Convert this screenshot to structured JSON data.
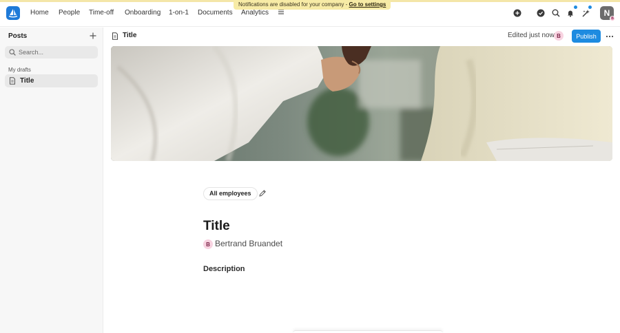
{
  "banner": {
    "text": "Notifications are disabled for your company - ",
    "link": "Go to settings"
  },
  "nav": {
    "items": [
      "Home",
      "People",
      "Time-off",
      "Onboarding",
      "1-on-1",
      "Documents",
      "Analytics"
    ],
    "user_initial": "N",
    "user_badge": "B"
  },
  "sidebar": {
    "title": "Posts",
    "search_placeholder": "Search...",
    "section_label": "My drafts",
    "items": [
      {
        "label": "Title"
      }
    ]
  },
  "doc_header": {
    "title": "Title",
    "edited_status": "Edited just now",
    "editor_initial": "B",
    "publish_label": "Publish"
  },
  "post": {
    "audience": "All employees",
    "title": "Title",
    "author_initial": "B",
    "author": "Bertrand Bruandet",
    "description": "Description"
  },
  "colors": {
    "accent": "#1e8be0",
    "banner_bg": "#f7eba6"
  }
}
